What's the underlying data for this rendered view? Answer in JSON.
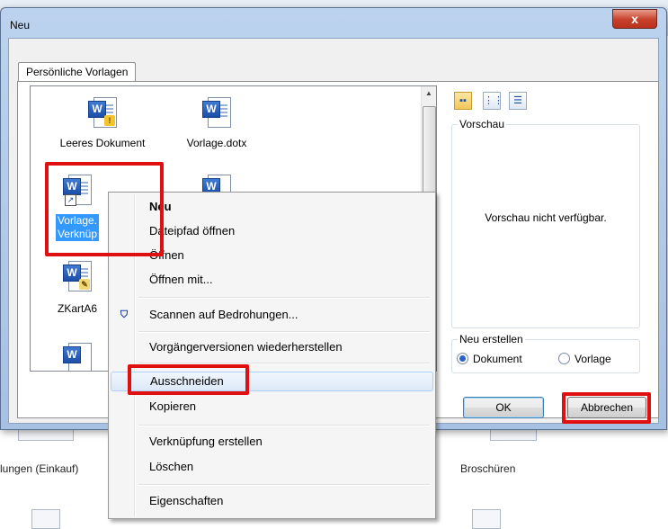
{
  "dialog": {
    "title": "Neu",
    "close_label": "x",
    "tab_label": "Persönliche Vorlagen"
  },
  "files": [
    {
      "label": "Leeres Dokument"
    },
    {
      "label": "Vorlage.dotx"
    },
    {
      "label_line1": "Vorlage.",
      "label_line2": "Verknüp"
    },
    {
      "label": "ZKartA6"
    }
  ],
  "view_buttons": [
    "large-icons",
    "list",
    "details"
  ],
  "preview": {
    "group_label": "Vorschau",
    "text": "Vorschau nicht verfügbar."
  },
  "create_new": {
    "group_label": "Neu erstellen",
    "options": [
      {
        "label": "Dokument",
        "selected": true
      },
      {
        "label": "Vorlage",
        "selected": false
      }
    ]
  },
  "buttons": {
    "ok": "OK",
    "cancel": "Abbrechen"
  },
  "context_menu": {
    "items": [
      {
        "label": "Neu",
        "bold": true
      },
      {
        "label": "Dateipfad öffnen"
      },
      {
        "label": "Öffnen"
      },
      {
        "label": "Öffnen mit..."
      },
      {
        "label": "Scannen auf Bedrohungen...",
        "icon": "shield-icon"
      },
      {
        "label": "Vorgängerversionen wiederherstellen"
      },
      {
        "label": "Ausschneiden",
        "hover": true
      },
      {
        "label": "Kopieren"
      },
      {
        "label": "Verknüpfung erstellen"
      },
      {
        "label": "Löschen"
      },
      {
        "label": "Eigenschaften"
      }
    ]
  },
  "background": {
    "left_label": "lungen (Einkauf)",
    "right_label": "Broschüren"
  },
  "colors": {
    "highlight": "#e01010",
    "selection": "#3399ff"
  }
}
